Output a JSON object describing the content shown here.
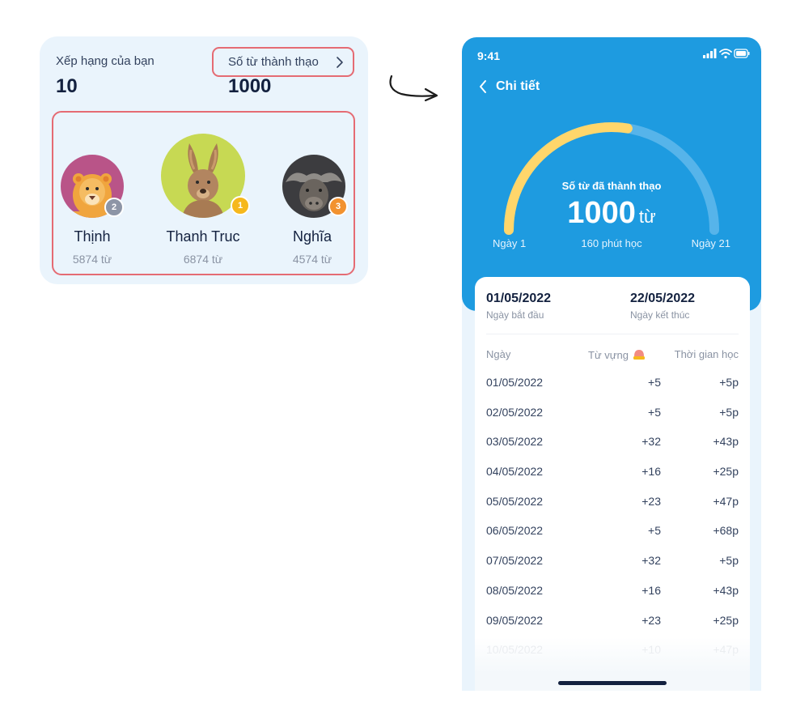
{
  "ranking_card": {
    "rank_label": "Xếp hạng của bạn",
    "rank_value": "10",
    "words_link_label": "Số từ thành thạo",
    "words_value": "1000",
    "members": [
      {
        "name": "Thịnh",
        "count": "5874 từ",
        "badge": "2",
        "badge_color": "#8d95a6",
        "avatar_bg": "#b95488",
        "animal": "lion"
      },
      {
        "name": "Thanh Truc",
        "count": "6874 từ",
        "badge": "1",
        "badge_color": "#f6b81c",
        "avatar_bg": "#c7d953",
        "animal": "kangaroo"
      },
      {
        "name": "Nghĩa",
        "count": "4574 từ",
        "badge": "3",
        "badge_color": "#f2922f",
        "avatar_bg": "#3c3c3f",
        "animal": "buffalo"
      }
    ]
  },
  "detail_screen": {
    "status_time": "9:41",
    "back_label": "Chi tiết",
    "gauge": {
      "title": "Số từ đã thành thạo",
      "value": "1000",
      "unit": "từ",
      "start_day": "Ngày 1",
      "minutes": "160 phút học",
      "end_day": "Ngày 21",
      "progress_fraction": 0.55
    },
    "start_date": "01/05/2022",
    "start_date_label": "Ngày bắt đầu",
    "end_date": "22/05/2022",
    "end_date_label": "Ngày kết thúc",
    "table": {
      "col_date": "Ngày",
      "col_vocab": "Từ vựng",
      "col_time": "Thời gian học",
      "rows": [
        {
          "date": "01/05/2022",
          "vocab": "+5",
          "time": "+5p"
        },
        {
          "date": "02/05/2022",
          "vocab": "+5",
          "time": "+5p"
        },
        {
          "date": "03/05/2022",
          "vocab": "+32",
          "time": "+43p"
        },
        {
          "date": "04/05/2022",
          "vocab": "+16",
          "time": "+25p"
        },
        {
          "date": "05/05/2022",
          "vocab": "+23",
          "time": "+47p"
        },
        {
          "date": "06/05/2022",
          "vocab": "+5",
          "time": "+68p"
        },
        {
          "date": "07/05/2022",
          "vocab": "+32",
          "time": "+5p"
        },
        {
          "date": "08/05/2022",
          "vocab": "+16",
          "time": "+43p"
        },
        {
          "date": "09/05/2022",
          "vocab": "+23",
          "time": "+25p"
        },
        {
          "date": "10/05/2022",
          "vocab": "+10",
          "time": "+47p"
        }
      ]
    }
  },
  "colors": {
    "primary_blue": "#1e9be0",
    "highlight_red": "#e56b73",
    "gauge_yellow": "#ffd66b",
    "card_bg": "#eaf4fc"
  }
}
